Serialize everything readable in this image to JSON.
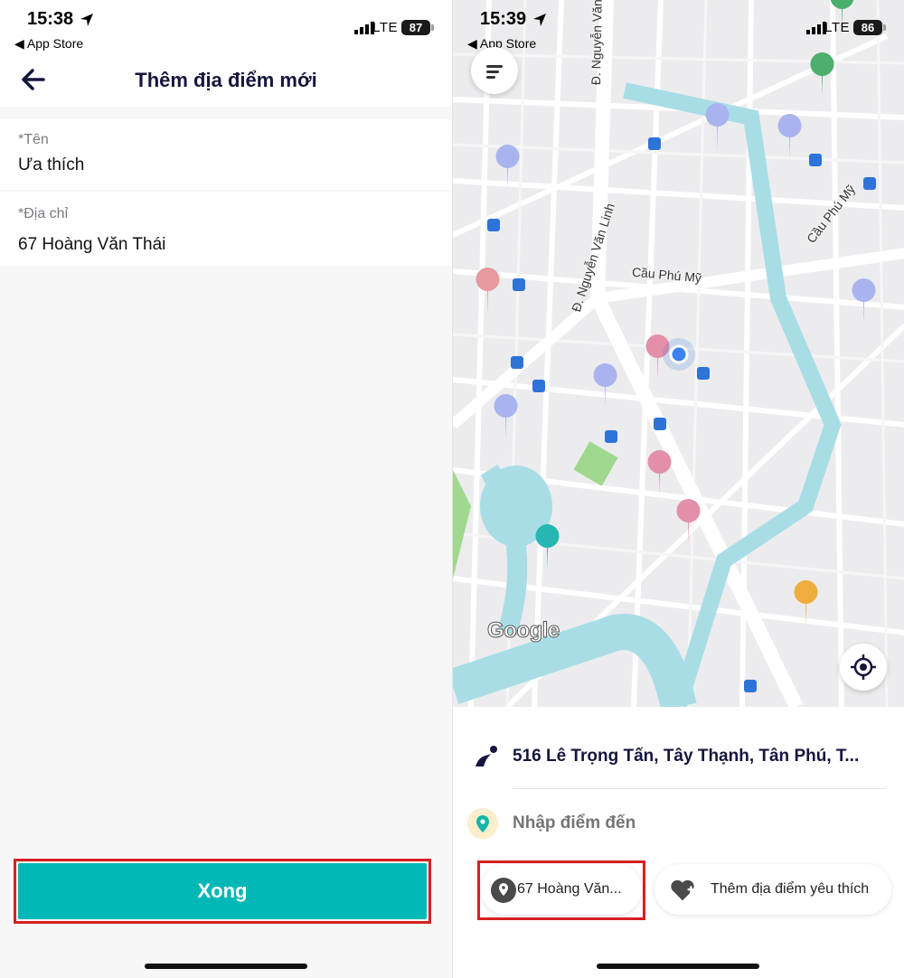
{
  "left_screen": {
    "status_bar": {
      "time": "15:38",
      "back_app": "◀ App Store",
      "network": "LTE",
      "battery": "87"
    },
    "header": {
      "title": "Thêm địa điểm mới"
    },
    "form": {
      "name_label": "*Tên",
      "name_value": "Ưa thích",
      "address_label": "*Địa chỉ",
      "address_value": "67 Hoàng Văn Thái"
    },
    "done_button": "Xong"
  },
  "right_screen": {
    "status_bar": {
      "time": "15:39",
      "back_app": "◀ App Store",
      "network": "LTE",
      "battery": "86"
    },
    "map": {
      "street_labels": [
        "Đ. Nguyễn Văn Linh",
        "Đ. Nguyễn Văn Linh",
        "Cầu Phú Mỹ",
        "Cầu Phú Mỹ"
      ],
      "logo": "Google"
    },
    "pickup": "516 Lê Trọng Tấn, Tây Thạnh, Tân Phú, T...",
    "destination_placeholder": "Nhập điểm đến",
    "saved_place_chip": "67 Hoàng Văn...",
    "add_favorite_chip": "Thêm địa điểm yêu thích"
  },
  "colors": {
    "accent": "#02b8b6",
    "highlight": "#d62020",
    "title_navy": "#15163d",
    "water": "#a8dde6",
    "park": "#9fd88e"
  }
}
